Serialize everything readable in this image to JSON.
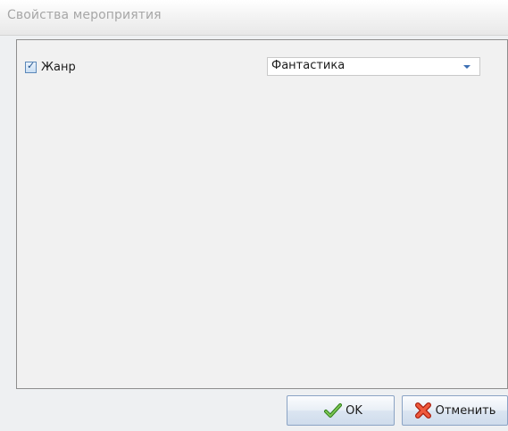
{
  "dialog": {
    "title": "Свойства мероприятия"
  },
  "form": {
    "genre_checked": true,
    "genre_label": "Жанр",
    "genre_value": "Фантастика"
  },
  "buttons": {
    "ok_label": "OK",
    "cancel_label": "Отменить"
  },
  "icons": {
    "ok": "checkmark-icon",
    "cancel": "red-x-icon",
    "combo": "chevron-down-icon"
  },
  "colors": {
    "title_text": "#a7a7a7",
    "accent_blue": "#3c6fb3",
    "ok_icon": "#4a9a2a",
    "cancel_icon": "#d9341f"
  }
}
